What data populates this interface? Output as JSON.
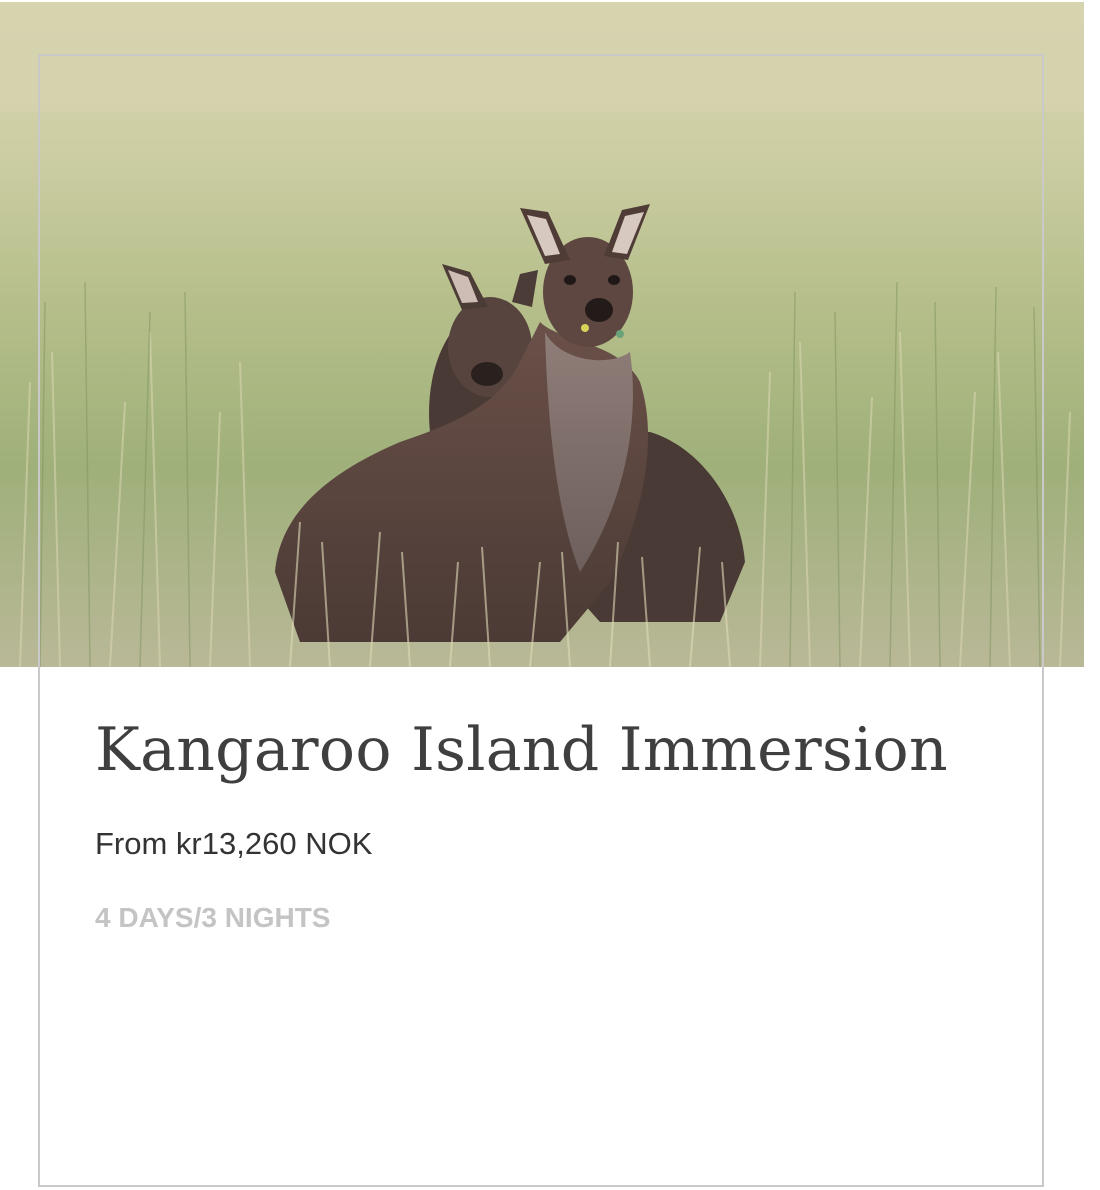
{
  "tour_card": {
    "image_subject": "two kangaroos in tall grass",
    "title": "Kangaroo Island Immersion",
    "price": "From kr13,260 NOK",
    "duration": "4 DAYS/3 NIGHTS"
  },
  "colors": {
    "title": "#3f3f3f",
    "price": "#333333",
    "duration": "#c4c4c4",
    "border": "#c9c9c9",
    "grass_light": "#d4d2ad",
    "grass_mid": "#a4b47c",
    "kangaroo_fur": "#5a4238"
  }
}
